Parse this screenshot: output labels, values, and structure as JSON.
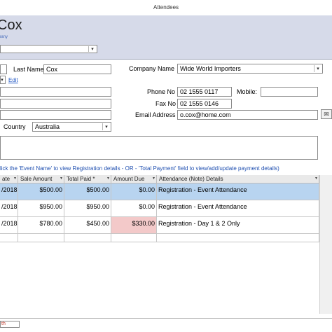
{
  "window": {
    "title": "Attendees"
  },
  "header": {
    "record_title": "Cox",
    "tab_fragment": "pany",
    "combo_value": ""
  },
  "form": {
    "last_name_label": "Last Name",
    "last_name_value": "Cox",
    "edit_link": "Edit",
    "company_label": "Company Name",
    "company_value": "Wide World Importers",
    "phone_label": "Phone No",
    "phone_value": "02 1555 0117",
    "mobile_label": "Mobile:",
    "mobile_value": "",
    "fax_label": "Fax No",
    "fax_value": "02 1555 0146",
    "email_label": "Email Address",
    "email_value": "o.cox@home.com",
    "country_label": "Country",
    "country_value": "Australia"
  },
  "info_text": "lick the 'Event Name' to view Registration details - OR - 'Total Payment' field to view/add/update payment details)",
  "grid": {
    "columns": [
      "ate",
      "Sale Amount",
      "Total Paid *",
      "Amount Due",
      "Attendance (Note) Details"
    ],
    "rows": [
      {
        "date": "/2018",
        "sale": "$500.00",
        "paid": "$500.00",
        "due": "$0.00",
        "details": "Registration - Event Attendance"
      },
      {
        "date": "/2018",
        "sale": "$950.00",
        "paid": "$950.00",
        "due": "$0.00",
        "details": "Registration - Event Attendance"
      },
      {
        "date": "/2018",
        "sale": "$780.00",
        "paid": "$450.00",
        "due": "$330.00",
        "details": "Registration  - Day 1 & 2 Only"
      }
    ]
  },
  "footer": {
    "nav_text": "th"
  },
  "colors": {
    "header_bg": "#d6dae9",
    "selected_row": "#b8d4f0",
    "due_highlight": "#f3c9c9",
    "link": "#2b5fc7"
  },
  "icons": {
    "dropdown": "chevron-down-icon",
    "email": "envelope-icon"
  }
}
